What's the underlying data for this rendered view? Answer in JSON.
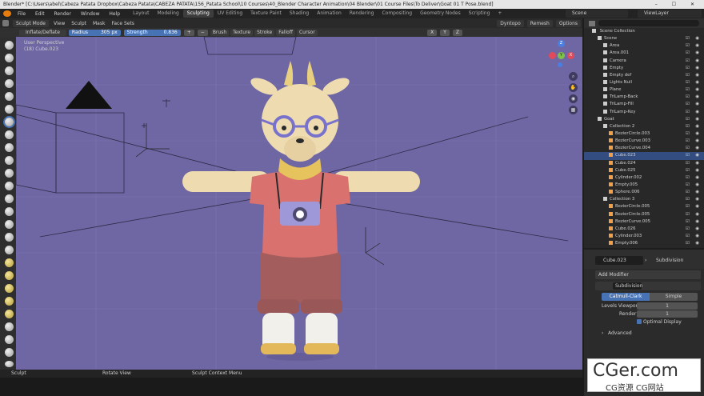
{
  "window": {
    "title": "Blender* [C:\\Users\\abel\\Cabeza Patata Dropbox\\Cabeza Patata\\CABEZA PATATA\\156_Patata School\\10 Courses\\40_Blender Character Animation\\04 Blender\\01 Course Files\\To Deliver\\Goat 01 T Pose.blend]",
    "controls": "– ☐ ✕"
  },
  "topbar": {
    "menus": [
      "File",
      "Edit",
      "Render",
      "Window",
      "Help"
    ],
    "tabs": [
      "Layout",
      "Modeling",
      "Sculpting",
      "UV Editing",
      "Texture Paint",
      "Shading",
      "Animation",
      "Rendering",
      "Compositing",
      "Geometry Nodes",
      "Scripting"
    ],
    "active_tab": "Sculpting",
    "add_tab": "+",
    "scene": "Scene",
    "view_layer": "ViewLayer"
  },
  "viewport_header": {
    "mode": "Sculpt Mode",
    "items": [
      "View",
      "Sculpt",
      "Mask",
      "Face Sets"
    ],
    "dyntopo": "Dyntopo",
    "remesh": "Remesh",
    "options": "Options"
  },
  "tool_settings": {
    "brush": "Inflate/Deflate",
    "radius_label": "Radius",
    "radius_value": "305 px",
    "strength_label": "Strength",
    "strength_value": "0.836",
    "plus": "+",
    "minus": "−",
    "dropdowns": [
      "Brush",
      "Texture",
      "Stroke",
      "Falloff",
      "Cursor"
    ],
    "axes": [
      "X",
      "Y",
      "Z"
    ]
  },
  "viewport": {
    "perspective": "User Perspective",
    "object": "(18) Cube.023",
    "gizmo": {
      "x": "X",
      "y": "Y",
      "z": "Z"
    },
    "colors": {
      "background": "#6f67a3",
      "x_axis": "#e04a5a",
      "y_axis": "#7ec04a",
      "z_axis": "#4a7ee0"
    }
  },
  "statusbar": {
    "items": [
      "Sculpt",
      "Rotate View",
      "Sculpt Context Menu"
    ]
  },
  "outliner": {
    "title": "Scene Collection",
    "rows": [
      {
        "label": "Scene",
        "depth": 1,
        "selected": false
      },
      {
        "label": "Area",
        "depth": 2,
        "selected": false
      },
      {
        "label": "Area.001",
        "depth": 2,
        "selected": false
      },
      {
        "label": "Camera",
        "depth": 2,
        "selected": false
      },
      {
        "label": "Empty",
        "depth": 2,
        "selected": false
      },
      {
        "label": "Empty def",
        "depth": 2,
        "selected": false
      },
      {
        "label": "Lights Null",
        "depth": 2,
        "selected": false
      },
      {
        "label": "Plane",
        "depth": 2,
        "selected": false
      },
      {
        "label": "TriLamp-Back",
        "depth": 2,
        "selected": false
      },
      {
        "label": "TriLamp-Fill",
        "depth": 2,
        "selected": false
      },
      {
        "label": "TriLamp-Key",
        "depth": 2,
        "selected": false
      },
      {
        "label": "Goat",
        "depth": 1,
        "selected": false
      },
      {
        "label": "Collection 2",
        "depth": 2,
        "selected": false
      },
      {
        "label": "BezierCircle.003",
        "depth": 3,
        "selected": false
      },
      {
        "label": "BezierCurve.003",
        "depth": 3,
        "selected": false
      },
      {
        "label": "BezierCurve.004",
        "depth": 3,
        "selected": false
      },
      {
        "label": "Cube.023",
        "depth": 3,
        "selected": true
      },
      {
        "label": "Cube.024",
        "depth": 3,
        "selected": false
      },
      {
        "label": "Cube.025",
        "depth": 3,
        "selected": false
      },
      {
        "label": "Cylinder.002",
        "depth": 3,
        "selected": false
      },
      {
        "label": "Empty.005",
        "depth": 3,
        "selected": false
      },
      {
        "label": "Sphere.006",
        "depth": 3,
        "selected": false
      },
      {
        "label": "Collection 3",
        "depth": 2,
        "selected": false
      },
      {
        "label": "BezierCircle.005",
        "depth": 3,
        "selected": false
      },
      {
        "label": "BezierCircle.005",
        "depth": 3,
        "selected": false
      },
      {
        "label": "BezierCurve.005",
        "depth": 3,
        "selected": false
      },
      {
        "label": "Cube.026",
        "depth": 3,
        "selected": false
      },
      {
        "label": "Cylinder.003",
        "depth": 3,
        "selected": false
      },
      {
        "label": "Empty.006",
        "depth": 3,
        "selected": false
      }
    ]
  },
  "properties": {
    "object": "Cube.023",
    "modifier_icon_label": "Subdivision",
    "add_modifier": "Add Modifier",
    "modifier_name": "Subdivision",
    "catmull": "Catmull-Clark",
    "simple": "Simple",
    "levels_label": "Levels Viewport",
    "levels_value": "1",
    "render_label": "Render",
    "render_value": "1",
    "optimal": "Optimal Display",
    "advanced": "Advanced"
  },
  "watermark": {
    "brand": "CGer.com",
    "sub": "CG资源 CG网站"
  }
}
